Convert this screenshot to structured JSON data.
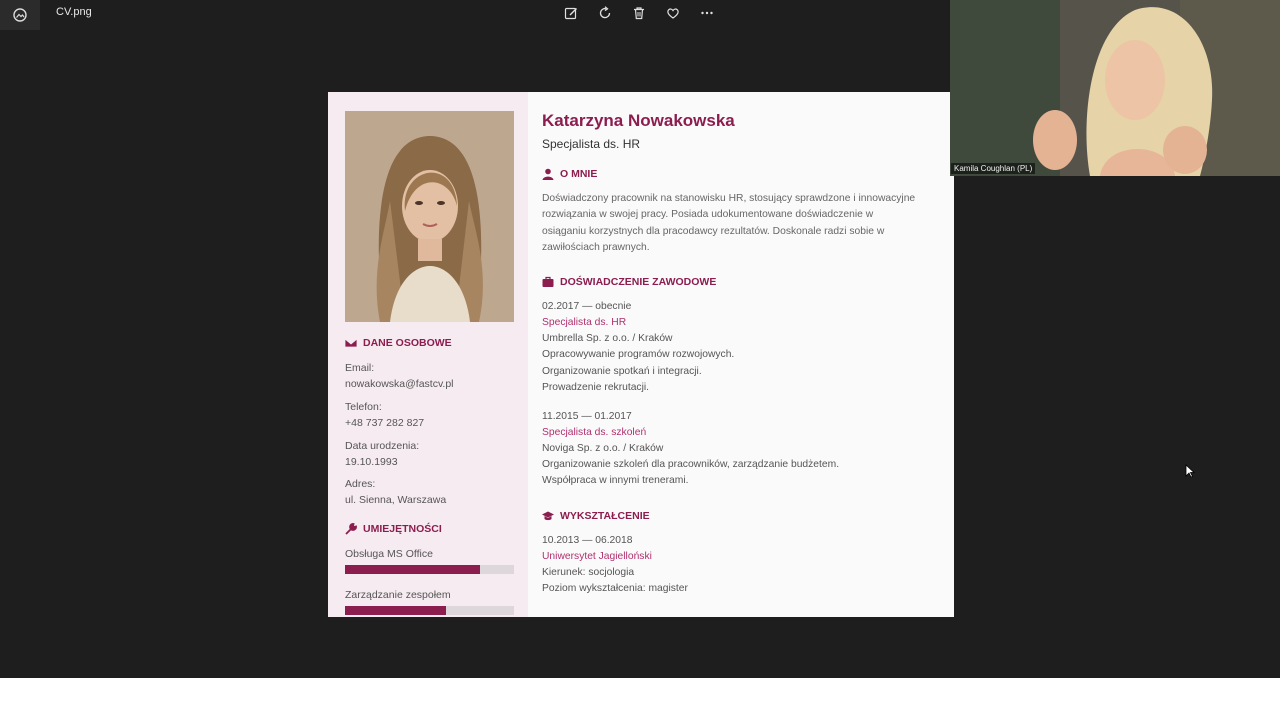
{
  "window": {
    "file_name": "CV.png"
  },
  "toolbar": {
    "icons": [
      "edit-icon",
      "rotate-icon",
      "delete-icon",
      "favorite-icon",
      "more-icon"
    ]
  },
  "cv": {
    "name": "Katarzyna Nowakowska",
    "role": "Specjalista ds. HR",
    "sections": {
      "about": "O MNIE",
      "experience": "DOŚWIADCZENIE ZAWODOWE",
      "education": "WYKSZTAŁCENIE",
      "personal": "DANE OSOBOWE",
      "skills": "UMIEJĘTNOŚCI"
    },
    "about_lines": [
      "Doświadczony pracownik na stanowisku HR, stosujący sprawdzone i innowacyjne",
      "rozwiązania w swojej pracy. Posiada udokumentowane doświadczenie w",
      "osiąganiu korzystnych dla pracodawcy rezultatów. Doskonale radzi sobie w",
      "zawiłościach prawnych."
    ],
    "experience": [
      {
        "period": "02.2017 — obecnie",
        "title": "Specjalista ds. HR",
        "company": "Umbrella Sp. z o.o. / Kraków",
        "details": [
          "Opracowywanie programów rozwojowych.",
          "Organizowanie spotkań i integracji.",
          "Prowadzenie rekrutacji."
        ]
      },
      {
        "period": "11.2015 — 01.2017",
        "title": "Specjalista ds. szkoleń",
        "company": "Noviga Sp. z o.o. / Kraków",
        "details": [
          "Organizowanie szkoleń dla pracowników, zarządzanie budżetem.",
          "Współpraca w innymi trenerami."
        ]
      }
    ],
    "education": {
      "period": "10.2013 — 06.2018",
      "school": "Uniwersytet Jagielloński",
      "field": "Kierunek: socjologia",
      "level": "Poziom wykształcenia: magister"
    },
    "personal": {
      "email_label": "Email:",
      "email": "nowakowska@fastcv.pl",
      "phone_label": "Telefon:",
      "phone": "+48 737 282 827",
      "birth_label": "Data urodzenia:",
      "birth": "19.10.1993",
      "address_label": "Adres:",
      "address": "ul. Sienna, Warszawa"
    },
    "skills": [
      {
        "name": "Obsługa MS Office",
        "level": 0.8
      },
      {
        "name": "Zarządzanie zespołem",
        "level": 0.6
      }
    ]
  },
  "webcam": {
    "participant": "Kamila Coughlan (PL)"
  },
  "colors": {
    "accent": "#8c1d4f",
    "sidebar": "#f6ebf1",
    "viewer_bg": "#1e1e1e"
  }
}
